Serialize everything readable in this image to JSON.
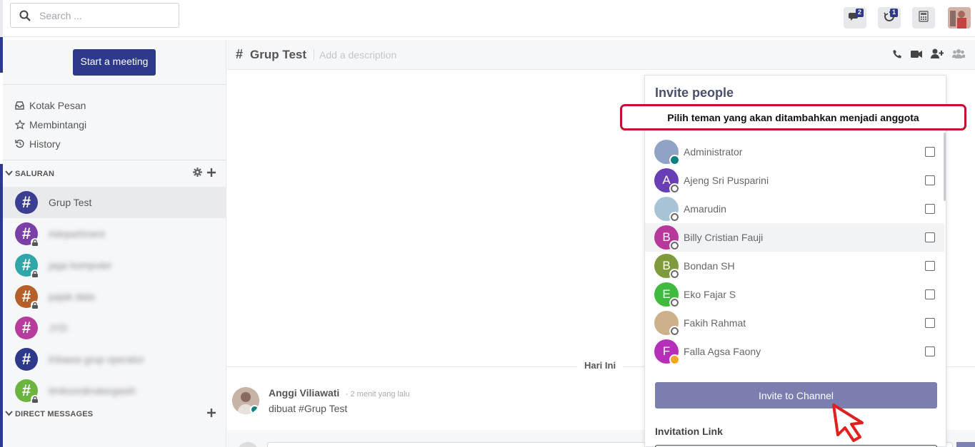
{
  "topbar": {
    "search_placeholder": "Search ...",
    "badges": {
      "discussions": "2",
      "threads": "1"
    },
    "icons": [
      "search-icon",
      "discussion-icon",
      "threads-icon",
      "calendar-icon",
      "user-avatar"
    ]
  },
  "sidebar": {
    "start_meeting": "Start a meeting",
    "menu": [
      {
        "label": "Kotak Pesan",
        "icon": "inbox-icon"
      },
      {
        "label": "Membintangi",
        "icon": "star-icon"
      },
      {
        "label": "History",
        "icon": "history-icon"
      }
    ],
    "channels_header": "SALURAN",
    "channels": [
      {
        "name": "Grup Test",
        "color": "#3b3e91",
        "locked": false,
        "blurred": false
      },
      {
        "name": "#department",
        "color": "#7b3fa8",
        "locked": true,
        "blurred": true
      },
      {
        "name": "jaga komputer",
        "color": "#2fa6a8",
        "locked": true,
        "blurred": true
      },
      {
        "name": "pajak data",
        "color": "#b5602a",
        "locked": true,
        "blurred": true
      },
      {
        "name": "JYD",
        "color": "#b83b9e",
        "locked": false,
        "blurred": true
      },
      {
        "name": "Kibawa grup operator",
        "color": "#2d3a8c",
        "locked": false,
        "blurred": true
      },
      {
        "name": "timkoordinatorgasih",
        "color": "#6bb43f",
        "locked": true,
        "blurred": true
      }
    ],
    "dm_header": "DIRECT MESSAGES"
  },
  "chat": {
    "title": "Grup Test",
    "description_placeholder": "Add a description",
    "day_label": "Hari Ini",
    "message": {
      "author": "Anggi Viliawati",
      "time": "- 2 menit yang lalu",
      "text": "dibuat #Grup Test"
    }
  },
  "invite": {
    "title": "Invite people",
    "tip": "Pilih teman yang akan ditambahkan menjadi anggota",
    "people": [
      {
        "name": "Administrator",
        "initial": "",
        "color": "#8fa3c4",
        "status": "on"
      },
      {
        "name": "Ajeng Sri Pusparini",
        "initial": "A",
        "color": "#6a3fb5",
        "status": "off"
      },
      {
        "name": "Amarudin",
        "initial": "",
        "color": "#a9c3d6",
        "status": "off"
      },
      {
        "name": "Billy Cristian Fauji",
        "initial": "B",
        "color": "#b8379b",
        "status": "off"
      },
      {
        "name": "Bondan SH",
        "initial": "B",
        "color": "#7f9a3a",
        "status": "off"
      },
      {
        "name": "Eko Fajar S",
        "initial": "E",
        "color": "#3fba3f",
        "status": "off"
      },
      {
        "name": "Fakih Rahmat",
        "initial": "",
        "color": "#cdb089",
        "status": "off"
      },
      {
        "name": "Falla Agsa Faony",
        "initial": "F",
        "color": "#b52fb8",
        "status": "away"
      }
    ],
    "invite_button": "Invite to Channel",
    "invitation_link_label": "Invitation Link"
  }
}
